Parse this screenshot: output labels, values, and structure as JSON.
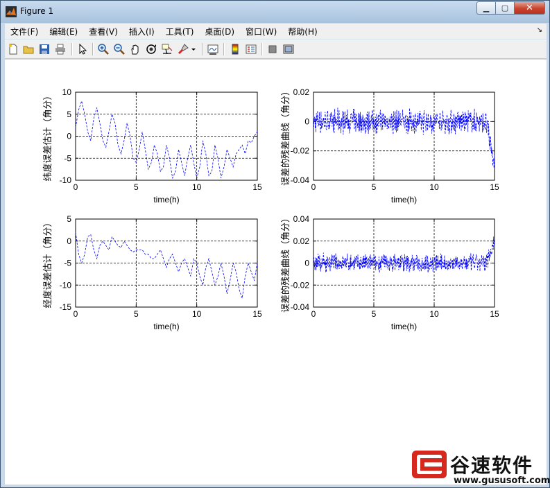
{
  "window": {
    "title": "Figure 1",
    "minimize_glyph": "▁",
    "maximize_glyph": "▢",
    "close_glyph": "✕"
  },
  "menu": [
    "文件(F)",
    "编辑(E)",
    "查看(V)",
    "插入(I)",
    "工具(T)",
    "桌面(D)",
    "窗口(W)",
    "帮助(H)"
  ],
  "menu_overflow_glyph": "↘",
  "toolbar": {
    "icons": [
      "new-figure-icon",
      "open-file-icon",
      "save-icon",
      "print-icon",
      "edit-plot-arrow-icon",
      "zoom-in-icon",
      "zoom-out-icon",
      "pan-hand-icon",
      "rotate-3d-icon",
      "data-cursor-icon",
      "brush-icon",
      "brush-dropdown-icon",
      "link-plot-icon",
      "colorbar-icon",
      "legend-icon",
      "hide-plot-tools-icon",
      "show-plot-tools-icon"
    ]
  },
  "colors": {
    "line": "#0000ff",
    "accent_red": "#d6281c"
  },
  "watermark": {
    "brand": "谷速软件",
    "url": "www.gususoft.com"
  },
  "chart_data": [
    {
      "type": "line",
      "xlabel": "time(h)",
      "ylabel": "纬度误差估计（角分）",
      "xlim": [
        0,
        15
      ],
      "ylim": [
        -10,
        10
      ],
      "xticks": [
        "0",
        "5",
        "10",
        "15"
      ],
      "yticks": [
        "10",
        "5",
        "0",
        "-5",
        "-10"
      ],
      "ytick_values": [
        10,
        5,
        0,
        -5,
        -10
      ],
      "grid": true,
      "series": [
        {
          "line_style": "dashed",
          "color": "#0000ff",
          "x": [
            0,
            0.25,
            0.5,
            0.75,
            1,
            1.25,
            1.5,
            1.75,
            2,
            2.25,
            2.5,
            2.75,
            3,
            3.25,
            3.5,
            3.75,
            4,
            4.25,
            4.5,
            4.75,
            5,
            5.25,
            5.5,
            5.75,
            6,
            6.25,
            6.5,
            6.75,
            7,
            7.25,
            7.5,
            7.75,
            8,
            8.25,
            8.5,
            8.75,
            9,
            9.25,
            9.5,
            9.75,
            10,
            10.25,
            10.5,
            10.75,
            11,
            11.25,
            11.5,
            11.75,
            12,
            12.25,
            12.5,
            12.75,
            13,
            13.25,
            13.5,
            13.75,
            14,
            14.25,
            14.5,
            14.75,
            15
          ],
          "y": [
            2,
            6,
            8,
            5,
            1,
            -1,
            4,
            6.5,
            3,
            -1,
            -2.5,
            1,
            5,
            3,
            -2,
            -4,
            -1,
            3,
            0,
            -5,
            -6,
            -3,
            1,
            -3,
            -7.5,
            -6,
            -2,
            -4,
            -8,
            -7,
            -2,
            -5,
            -9.5,
            -8,
            -3,
            -6,
            -9,
            -5,
            -2,
            -6,
            -9.5,
            -7,
            -1,
            -4,
            -9,
            -8,
            -2,
            -5,
            -9.5,
            -7,
            -3,
            -5,
            -7,
            -4,
            -3,
            -2,
            -4,
            -1,
            -1.5,
            0,
            1
          ]
        }
      ]
    },
    {
      "type": "line",
      "xlabel": "time(h)",
      "ylabel": "误差的残差曲线（角分）",
      "xlim": [
        0,
        15
      ],
      "ylim": [
        -0.04,
        0.02
      ],
      "xticks": [
        "0",
        "5",
        "10",
        "15"
      ],
      "yticks": [
        "0.02",
        "0",
        "-0.02",
        "-0.04"
      ],
      "ytick_values": [
        0.02,
        0,
        -0.02,
        -0.04
      ],
      "grid": true,
      "series": [
        {
          "line_style": "dashed",
          "color": "#0000ff",
          "noise": true,
          "baseline": 0.0,
          "amplitude": 0.008,
          "end_drop": -0.028
        }
      ]
    },
    {
      "type": "line",
      "xlabel": "time(h)",
      "ylabel": "经度误差估计（角分）",
      "xlim": [
        0,
        15
      ],
      "ylim": [
        -15,
        5
      ],
      "xticks": [
        "0",
        "5",
        "10",
        "15"
      ],
      "yticks": [
        "5",
        "0",
        "-5",
        "-10",
        "-15"
      ],
      "ytick_values": [
        5,
        0,
        -5,
        -10,
        -15
      ],
      "grid": true,
      "series": [
        {
          "line_style": "dashed",
          "color": "#0000ff",
          "x": [
            0,
            0.25,
            0.5,
            0.75,
            1,
            1.25,
            1.5,
            1.75,
            2,
            2.25,
            2.5,
            2.75,
            3,
            3.25,
            3.5,
            3.75,
            4,
            4.25,
            4.5,
            4.75,
            5,
            5.25,
            5.5,
            5.75,
            6,
            6.25,
            6.5,
            6.75,
            7,
            7.25,
            7.5,
            7.75,
            8,
            8.25,
            8.5,
            8.75,
            9,
            9.25,
            9.5,
            9.75,
            10,
            10.25,
            10.5,
            10.75,
            11,
            11.25,
            11.5,
            11.75,
            12,
            12.25,
            12.5,
            12.75,
            13,
            13.25,
            13.5,
            13.75,
            14,
            14.25,
            14.5,
            14.75,
            15
          ],
          "y": [
            2,
            -3,
            -5,
            -3,
            1,
            1.5,
            -2,
            -4,
            -1,
            0,
            -1,
            -2,
            1,
            0,
            -1,
            -1.5,
            0,
            -1,
            -2,
            -2.5,
            -2,
            -2,
            -2,
            -3,
            -3,
            -4,
            -4,
            -3,
            -2,
            -4,
            -6,
            -4,
            -3,
            -5,
            -7,
            -5,
            -4,
            -6,
            -8,
            -4,
            -5,
            -8,
            -10,
            -6,
            -4,
            -7,
            -10,
            -8,
            -5,
            -8,
            -12,
            -9,
            -5,
            -7,
            -11,
            -13,
            -8,
            -5,
            -7,
            -9,
            -5
          ]
        }
      ]
    },
    {
      "type": "line",
      "xlabel": "time(h)",
      "ylabel": "误差的残差曲线（角分）",
      "xlim": [
        0,
        15
      ],
      "ylim": [
        -0.04,
        0.04
      ],
      "xticks": [
        "0",
        "5",
        "10",
        "15"
      ],
      "yticks": [
        "0.04",
        "0.02",
        "0",
        "-0.02",
        "-0.04"
      ],
      "ytick_values": [
        0.04,
        0.02,
        0,
        -0.02,
        -0.04
      ],
      "grid": true,
      "series": [
        {
          "line_style": "dashed",
          "color": "#0000ff",
          "noise": true,
          "baseline": 0.0,
          "amplitude": 0.008,
          "end_drop": 0.02
        }
      ]
    }
  ]
}
